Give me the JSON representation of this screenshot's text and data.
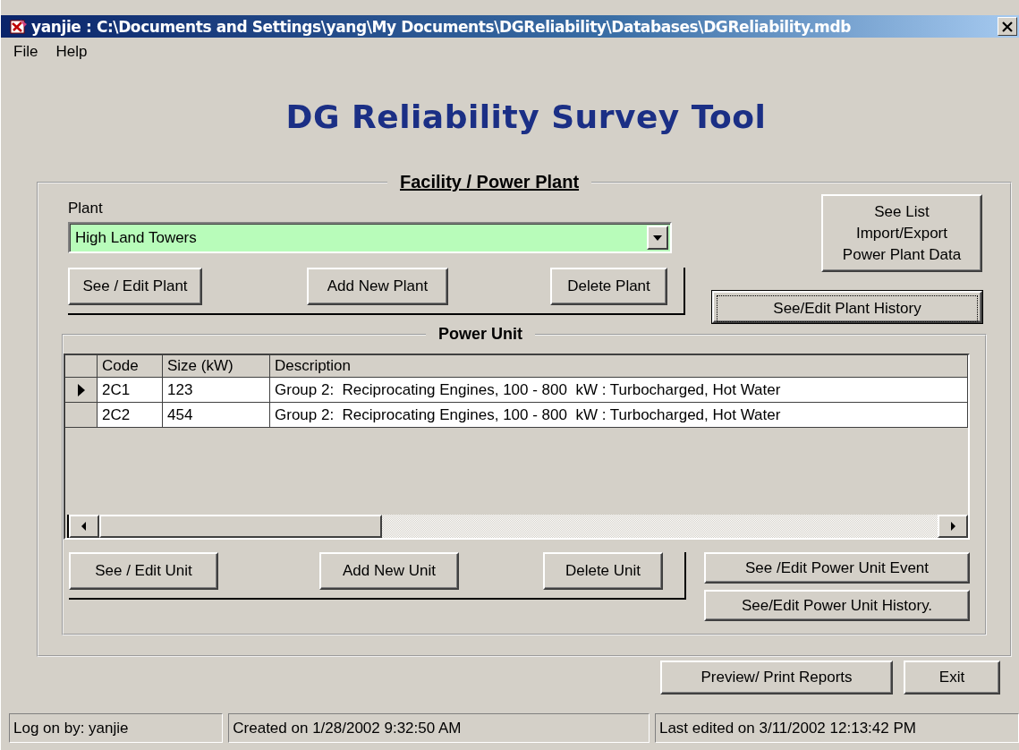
{
  "window": {
    "title": "yanjie : C:\\Documents and Settings\\yang\\My Documents\\DGReliability\\Databases\\DGReliability.mdb"
  },
  "menu": [
    "File",
    "Help"
  ],
  "app_title": "DG Reliability Survey Tool",
  "facility": {
    "legend": "Facility / Power Plant",
    "plant_label": "Plant",
    "plant_combo": {
      "value": "High Land Towers"
    },
    "buttons": [
      "See / Edit Plant",
      "Add New Plant",
      "Delete Plant"
    ],
    "list_button": {
      "lines": [
        "See List",
        "Import/Export",
        "Power Plant Data"
      ]
    },
    "history_button": {
      "label": "See/Edit Plant History",
      "focused": true
    }
  },
  "power_unit": {
    "legend": "Power Unit",
    "table": {
      "columns": [
        "Code",
        "Size (kW)",
        "Description"
      ],
      "rows": [
        {
          "selected": true,
          "cells": [
            "2C1",
            "123",
            "Group 2:  Reciprocating Engines, 100 - 800  kW : Turbocharged, Hot Water"
          ]
        },
        {
          "selected": false,
          "cells": [
            "2C2",
            "454",
            "Group 2:  Reciprocating Engines, 100 - 800  kW : Turbocharged, Hot Water"
          ]
        }
      ]
    },
    "buttons": [
      "See / Edit Unit",
      "Add New Unit",
      "Delete Unit"
    ],
    "side_buttons": [
      "See /Edit Power Unit Event",
      "See/Edit Power Unit History."
    ]
  },
  "footer_buttons": [
    "Preview/ Print Reports",
    "Exit"
  ],
  "status_bar": [
    "Log on by: yanjie",
    "Created on 1/28/2002 9:32:50 AM",
    "Last edited on 3/11/2002 12:13:42 PM"
  ]
}
